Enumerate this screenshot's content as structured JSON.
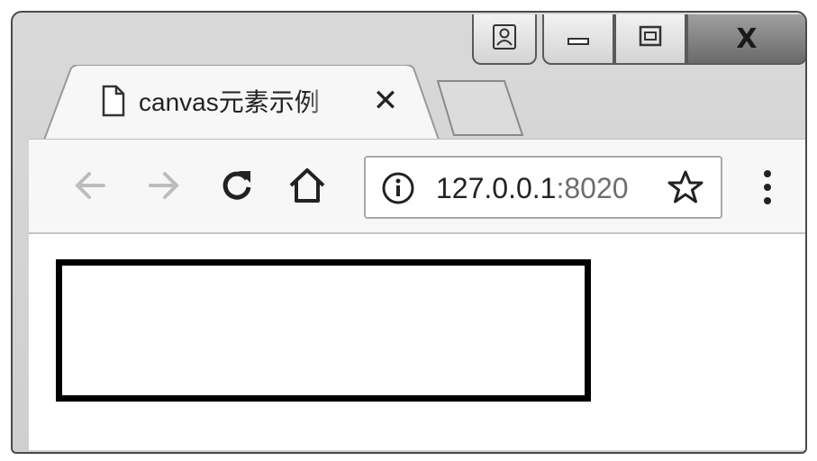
{
  "tab": {
    "title": "canvas元素示例",
    "close_glyph": "✕",
    "page_icon": "page-icon"
  },
  "window_controls": {
    "user": "user-icon",
    "minimize": "minimize-icon",
    "maximize": "maximize-icon",
    "close_label": "X"
  },
  "toolbar": {
    "back": "back-arrow-icon",
    "forward": "forward-arrow-icon",
    "reload": "reload-icon",
    "home": "home-icon",
    "menu": "more-vertical-icon"
  },
  "address_bar": {
    "host": "127.0.0.1",
    "port": ":8020",
    "info_icon": "info-icon",
    "bookmark_icon": "star-icon"
  },
  "colors": {
    "canvas_border": "#000000",
    "frame": "#d4d4d4",
    "toolbar": "#f7f7f7"
  }
}
